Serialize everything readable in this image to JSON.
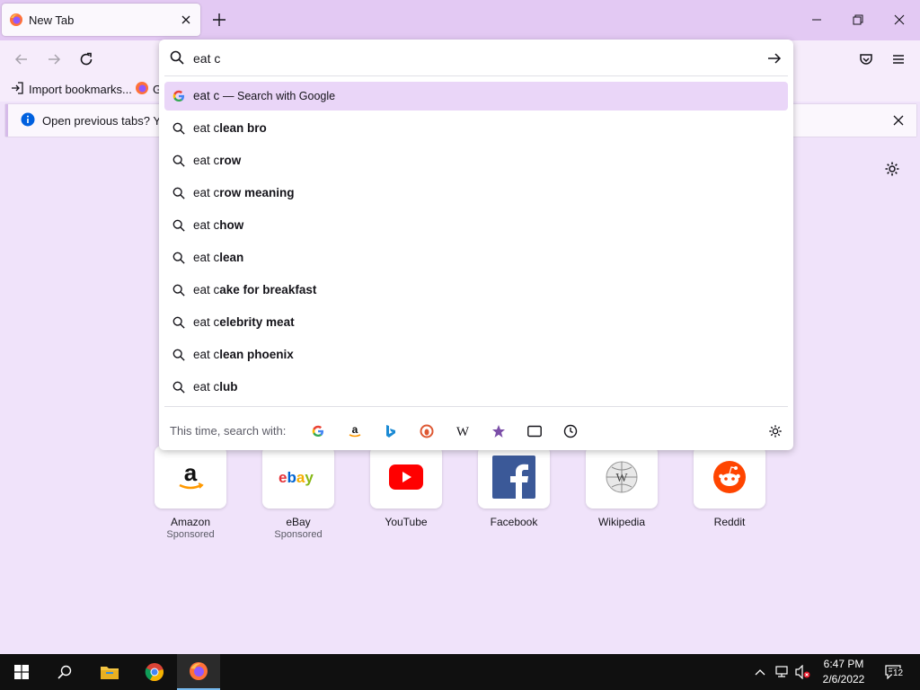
{
  "tab": {
    "title": "New Tab"
  },
  "bookmarks": {
    "import_label": "Import bookmarks...",
    "second_label": "G"
  },
  "notification": {
    "text": "Open previous tabs? You"
  },
  "urlbar": {
    "value": "eat c",
    "results": [
      {
        "typed": "eat c",
        "rest": "",
        "action": "— Search with Google",
        "icon": "google-icon",
        "selected": true
      },
      {
        "typed": "eat c",
        "rest": "lean bro"
      },
      {
        "typed": "eat c",
        "rest": "row"
      },
      {
        "typed": "eat c",
        "rest": "row meaning"
      },
      {
        "typed": "eat c",
        "rest": "how"
      },
      {
        "typed": "eat c",
        "rest": "lean"
      },
      {
        "typed": "eat c",
        "rest": "ake for breakfast"
      },
      {
        "typed": "eat c",
        "rest": "elebrity meat"
      },
      {
        "typed": "eat c",
        "rest": "lean phoenix"
      },
      {
        "typed": "eat c",
        "rest": "lub"
      }
    ],
    "one_off_label": "This time, search with:",
    "engines": [
      "google-icon",
      "amazon-icon",
      "bing-icon",
      "duckduckgo-icon",
      "wikipedia-icon",
      "bookmarks-star-icon",
      "tabs-icon",
      "history-icon"
    ]
  },
  "shortcuts": [
    {
      "name": "Amazon",
      "sponsored": "Sponsored"
    },
    {
      "name": "eBay",
      "sponsored": "Sponsored"
    },
    {
      "name": "YouTube",
      "sponsored": ""
    },
    {
      "name": "Facebook",
      "sponsored": ""
    },
    {
      "name": "Wikipedia",
      "sponsored": ""
    },
    {
      "name": "Reddit",
      "sponsored": ""
    }
  ],
  "taskbar": {
    "time": "6:47 PM",
    "date": "2/6/2022",
    "notifications": "12"
  },
  "colors": {
    "accent": "#e3c9f3",
    "selected": "#ead6f8",
    "background": "#f0e3fa"
  }
}
